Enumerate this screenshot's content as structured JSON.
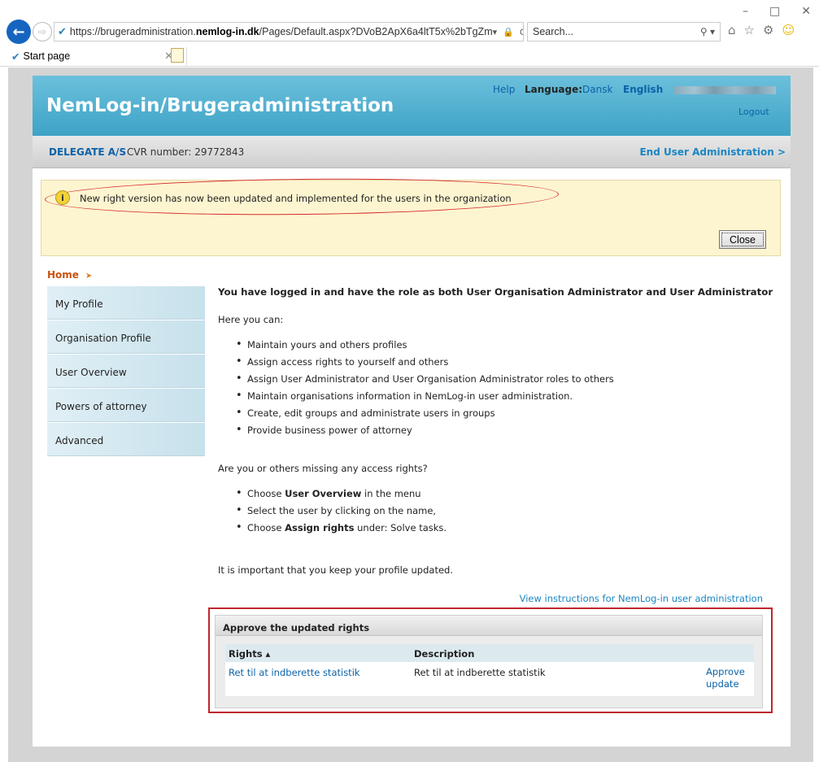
{
  "browser": {
    "url_prefix": "https://brugeradministration.",
    "url_host": "nemlog-in.dk",
    "url_path": "/Pages/Default.aspx?DVoB2ApX6a4ltT5x%2bTgZm",
    "url_tools": "▾ 🔒 C",
    "search_placeholder": "Search...",
    "tab_title": "Start page"
  },
  "header": {
    "title": "NemLog-in/Brugeradministration",
    "help": "Help",
    "language_label": "Language:",
    "lang_dansk": "Dansk",
    "lang_english": "English",
    "logout": "Logout"
  },
  "orgbar": {
    "org_name": "DELEGATE A/S",
    "cvr": "CVR number: 29772843",
    "end_user_admin": "End User Administration >"
  },
  "notice": {
    "message": "New right version has now been updated and implemented for the users in the organization",
    "close": "Close"
  },
  "breadcrumb": {
    "home": "Home"
  },
  "sidebar": {
    "items": [
      {
        "label": "My Profile"
      },
      {
        "label": "Organisation Profile"
      },
      {
        "label": "User Overview"
      },
      {
        "label": "Powers of attorney"
      },
      {
        "label": "Advanced"
      }
    ]
  },
  "content": {
    "lead": "You have logged in and have the role as both User Organisation Administrator and User Administrator",
    "here_you_can": "Here you can:",
    "bullets": [
      "Maintain yours and others profiles",
      "Assign access rights to yourself and others",
      "Assign User Administrator and User Organisation Administrator roles to others",
      "Maintain organisations information in NemLog-in user administration.",
      "Create, edit groups and administrate users in groups",
      "Provide business power of attorney"
    ],
    "missing_q": "Are you or others missing any access rights?",
    "steps": {
      "s1_pre": "Choose ",
      "s1_bold": "User Overview",
      "s1_post": " in the menu",
      "s2": "Select the user by clicking on the name,",
      "s3_pre": "Choose ",
      "s3_bold": "Assign rights",
      "s3_post": " under: Solve tasks."
    },
    "keep_updated": "It is important that you keep your profile updated.",
    "instructions_link": "View instructions for NemLog-in user administration"
  },
  "approve": {
    "title": "Approve the updated rights",
    "col_rights": "Rights ▴",
    "col_description": "Description",
    "row_right": "Ret til at indberette statistik",
    "row_description": "Ret til at indberette statistik",
    "row_action_1": "Approve",
    "row_action_2": "update"
  }
}
